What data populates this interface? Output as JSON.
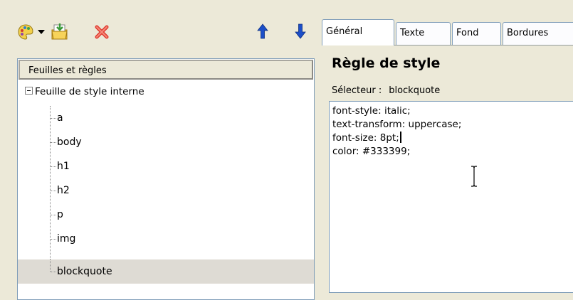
{
  "toolbar": {
    "icons": [
      "palette-icon",
      "dropdown-arrow-icon",
      "import-icon",
      "delete-icon",
      "move-up-icon",
      "move-down-icon"
    ],
    "colors": {
      "delete": "#e03a2f",
      "arrows": "#1c4fc8"
    }
  },
  "tree": {
    "header": "Feuilles et règles",
    "root_label": "Feuille de style interne",
    "items": [
      "a",
      "body",
      "h1",
      "h2",
      "p",
      "img",
      "blockquote"
    ],
    "selected": "blockquote"
  },
  "tabs": [
    {
      "label": "Général",
      "active": true
    },
    {
      "label": "Texte",
      "active": false
    },
    {
      "label": "Fond",
      "active": false
    },
    {
      "label": "Bordures",
      "active": false
    }
  ],
  "rule": {
    "title": "Règle de style",
    "selector_label": "Sélecteur :",
    "selector_value": "blockquote"
  },
  "editor": {
    "lines": [
      "font-style: italic;",
      "text-transform: uppercase;",
      "font-size: 8pt;",
      "color: #333399;"
    ],
    "caret_line": 3
  }
}
